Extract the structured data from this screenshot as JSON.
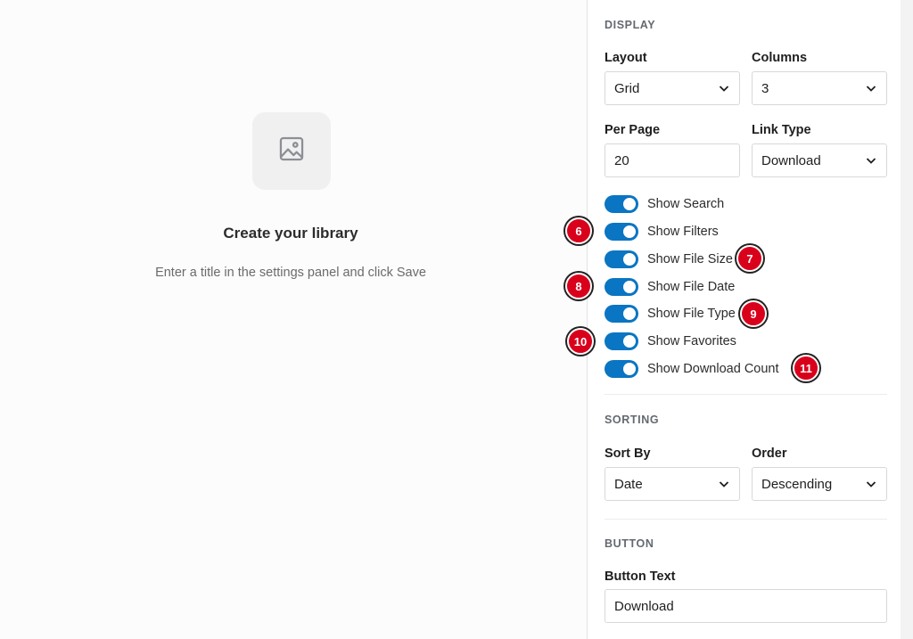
{
  "empty_state": {
    "icon": "image-placeholder-icon",
    "title": "Create your library",
    "subtitle": "Enter a title in the settings panel and click Save"
  },
  "display": {
    "section_title": "DISPLAY",
    "layout": {
      "label": "Layout",
      "value": "Grid"
    },
    "columns": {
      "label": "Columns",
      "value": "3"
    },
    "per_page": {
      "label": "Per Page",
      "value": "20"
    },
    "link_type": {
      "label": "Link Type",
      "value": "Download"
    },
    "toggles": [
      {
        "label": "Show Search",
        "on": true
      },
      {
        "label": "Show Filters",
        "on": true
      },
      {
        "label": "Show File Size",
        "on": true
      },
      {
        "label": "Show File Date",
        "on": true
      },
      {
        "label": "Show File Type",
        "on": true
      },
      {
        "label": "Show Favorites",
        "on": true
      },
      {
        "label": "Show Download Count",
        "on": true
      }
    ]
  },
  "sorting": {
    "section_title": "SORTING",
    "sort_by": {
      "label": "Sort By",
      "value": "Date"
    },
    "order": {
      "label": "Order",
      "value": "Descending"
    }
  },
  "button": {
    "section_title": "BUTTON",
    "button_text": {
      "label": "Button Text",
      "value": "Download"
    }
  },
  "callouts": [
    "6",
    "7",
    "8",
    "9",
    "10",
    "11"
  ],
  "colors": {
    "toggle_on": "#0a75c2",
    "callout": "#d9001b"
  }
}
